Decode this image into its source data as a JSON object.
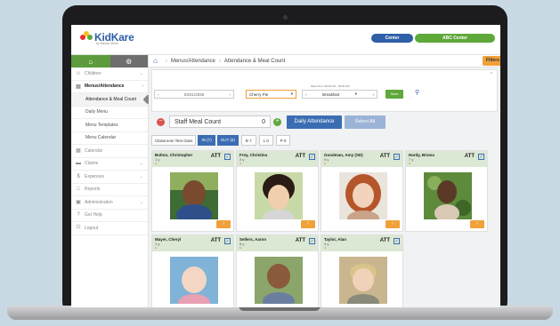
{
  "header": {
    "logo_text": "KidKare",
    "logo_sub": "by Minute Menu",
    "center_label": "Center",
    "center_name": "ABC Center"
  },
  "sidebar": {
    "items": [
      {
        "label": "Children",
        "icon": "child-icon"
      },
      {
        "label": "Menus/Attendance",
        "icon": "menu-icon"
      },
      {
        "label": "Attendance & Meal Count",
        "sub": true
      },
      {
        "label": "Daily Menu",
        "sub": true
      },
      {
        "label": "Menu Templates",
        "sub": true
      },
      {
        "label": "Menu Calendar",
        "sub": true
      },
      {
        "label": "Calendar",
        "icon": "calendar-icon"
      },
      {
        "label": "Claims",
        "icon": "claims-icon"
      },
      {
        "label": "Expenses",
        "icon": "dollar-icon"
      },
      {
        "label": "Reports",
        "icon": "report-icon"
      },
      {
        "label": "Administration",
        "icon": "admin-icon"
      },
      {
        "label": "Get Help",
        "icon": "help-icon"
      },
      {
        "label": "Logout",
        "icon": "power-icon"
      }
    ]
  },
  "breadcrumb": {
    "level1": "Menus/Attendance",
    "level2": "Attendance & Meal Count",
    "filters_label": "Filters"
  },
  "controls": {
    "date": "03/31/2025",
    "menu": "Cherry Pie",
    "meal_time_label": "Meal Time: 08:00 AM - 09:00 AM",
    "meal": "Breakfast",
    "save_label": "Save"
  },
  "staff": {
    "label": "Staff Meal Count",
    "count": "0",
    "attendance_label": "Daily Attendance",
    "select_all_label": "Select All"
  },
  "class_bar": {
    "class_label": "Classroom Test class",
    "in_label": "IN (7)",
    "out_label": "OUT (0)",
    "b_count": "B 7",
    "l_count": "L 0",
    "p_count": "P 0"
  },
  "children": [
    {
      "name": "Bolton, Christopher",
      "age": "1 y",
      "att": "ATT"
    },
    {
      "name": "Frey, Christina",
      "age": "3 y",
      "att": "ATT"
    },
    {
      "name": "Goodman, Amy (SD)",
      "age": "9 y",
      "att": "ATT"
    },
    {
      "name": "Hardy, Briana",
      "age": "7 y",
      "att": "ATT"
    },
    {
      "name": "Mayer, Cheryl",
      "age": "1 y",
      "att": "ATT"
    },
    {
      "name": "Sellers, Aaron",
      "age": "8 y",
      "att": "ATT"
    },
    {
      "name": "Taylor, Alan",
      "age": "4 y",
      "att": "ATT"
    }
  ],
  "colors": {
    "brand_blue": "#2f5fa7",
    "brand_green": "#5fa83a",
    "accent_orange": "#f0a13a"
  }
}
